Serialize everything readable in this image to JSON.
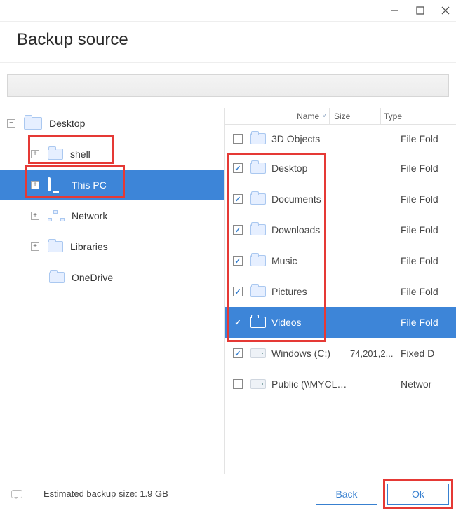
{
  "window": {
    "title": "Backup source"
  },
  "pathbar": {
    "value": ""
  },
  "tree": {
    "items": [
      {
        "label": "Desktop",
        "icon": "folder",
        "depth": 0,
        "expander": "−",
        "selected": false
      },
      {
        "label": "shell",
        "icon": "folder",
        "depth": 1,
        "expander": "+",
        "selected": false
      },
      {
        "label": "This PC",
        "icon": "pc",
        "depth": 1,
        "expander": "+",
        "selected": true
      },
      {
        "label": "Network",
        "icon": "network",
        "depth": 1,
        "expander": "+",
        "selected": false
      },
      {
        "label": "Libraries",
        "icon": "folder",
        "depth": 1,
        "expander": "+",
        "selected": false
      },
      {
        "label": "OneDrive",
        "icon": "folder",
        "depth": 1,
        "expander": "",
        "selected": false
      }
    ]
  },
  "list": {
    "columns": {
      "name": "Name",
      "size": "Size",
      "type": "Type"
    },
    "items": [
      {
        "name": "3D Objects",
        "icon": "folder",
        "checked": false,
        "size": "",
        "type": "File Fold",
        "selected": false
      },
      {
        "name": "Desktop",
        "icon": "folder",
        "checked": true,
        "size": "",
        "type": "File Fold",
        "selected": false
      },
      {
        "name": "Documents",
        "icon": "folder",
        "checked": true,
        "size": "",
        "type": "File Fold",
        "selected": false
      },
      {
        "name": "Downloads",
        "icon": "folder",
        "checked": true,
        "size": "",
        "type": "File Fold",
        "selected": false
      },
      {
        "name": "Music",
        "icon": "folder",
        "checked": true,
        "size": "",
        "type": "File Fold",
        "selected": false
      },
      {
        "name": "Pictures",
        "icon": "folder",
        "checked": true,
        "size": "",
        "type": "File Fold",
        "selected": false
      },
      {
        "name": "Videos",
        "icon": "folder",
        "checked": true,
        "size": "",
        "type": "File Fold",
        "selected": true
      },
      {
        "name": "Windows (C:)",
        "icon": "drive",
        "checked": true,
        "size": "74,201,2...",
        "type": "Fixed D",
        "selected": false
      },
      {
        "name": "Public (\\\\MYCLO...",
        "icon": "drive",
        "checked": false,
        "size": "",
        "type": "Networ",
        "selected": false
      }
    ]
  },
  "footer": {
    "estimate_label": "Estimated backup size:",
    "estimate_value": "1.9 GB",
    "back": "Back",
    "ok": "Ok"
  }
}
